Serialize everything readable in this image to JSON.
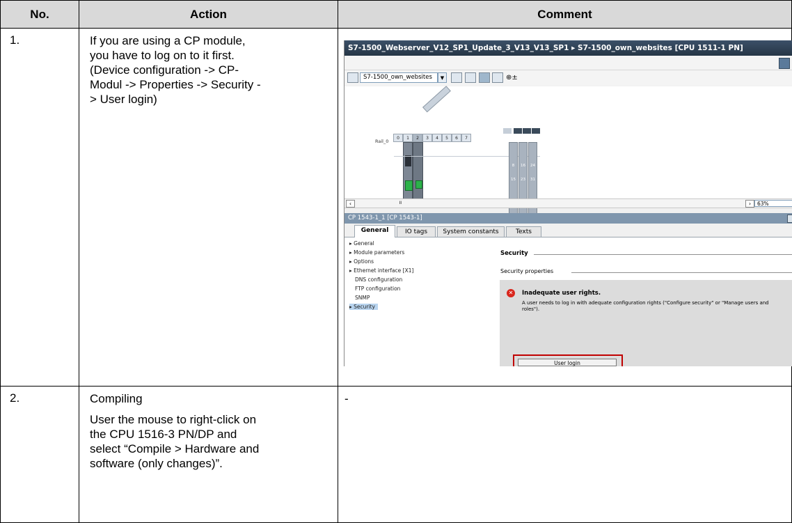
{
  "headers": {
    "no": "No.",
    "action": "Action",
    "comment": "Comment"
  },
  "rows": [
    {
      "no": "1.",
      "action_lines": [
        "If you are using a CP module,",
        "you have to log on to it first.",
        "(Device configuration -> CP-",
        "Modul -> Properties -> Security -",
        "> User login)"
      ]
    },
    {
      "no": "2.",
      "action_title": "Compiling",
      "action_lines": [
        "User the mouse to right-click on",
        "the CPU 1516-3 PN/DP and",
        "select “Compile > Hardware and",
        "software (only changes)”."
      ],
      "comment": "-"
    }
  ],
  "screenshot": {
    "title": "S7-1500_Webserver_V12_SP1_Update_3_V13_V13_SP1  ▸  S7-1500_own_websites [CPU 1511-1 PN]",
    "device_select": "S7-1500_own_websites",
    "rack_label": "Rail_0",
    "slots": [
      "0",
      "1",
      "2",
      "3",
      "4",
      "5",
      "6",
      "7"
    ],
    "ext_labels": [
      "8",
      "16",
      "24",
      "15",
      "23",
      "31"
    ],
    "zoom": "63%",
    "props_title": "CP 1543-1_1 [CP 1543-1]",
    "tabs": [
      "General",
      "IO tags",
      "System constants",
      "Texts"
    ],
    "nav_items": [
      "General",
      "Module parameters",
      "Options",
      "Ethernet interface [X1]",
      "DNS configuration",
      "FTP configuration",
      "SNMP",
      "Security"
    ],
    "section_title": "Security",
    "section_sub": "Security properties",
    "warning_title": "Inadequate user rights.",
    "warning_text": "A user needs to log in with adequate configuration rights (\"Configure security\" or \"Manage users and roles\").",
    "login_button": "User login"
  }
}
